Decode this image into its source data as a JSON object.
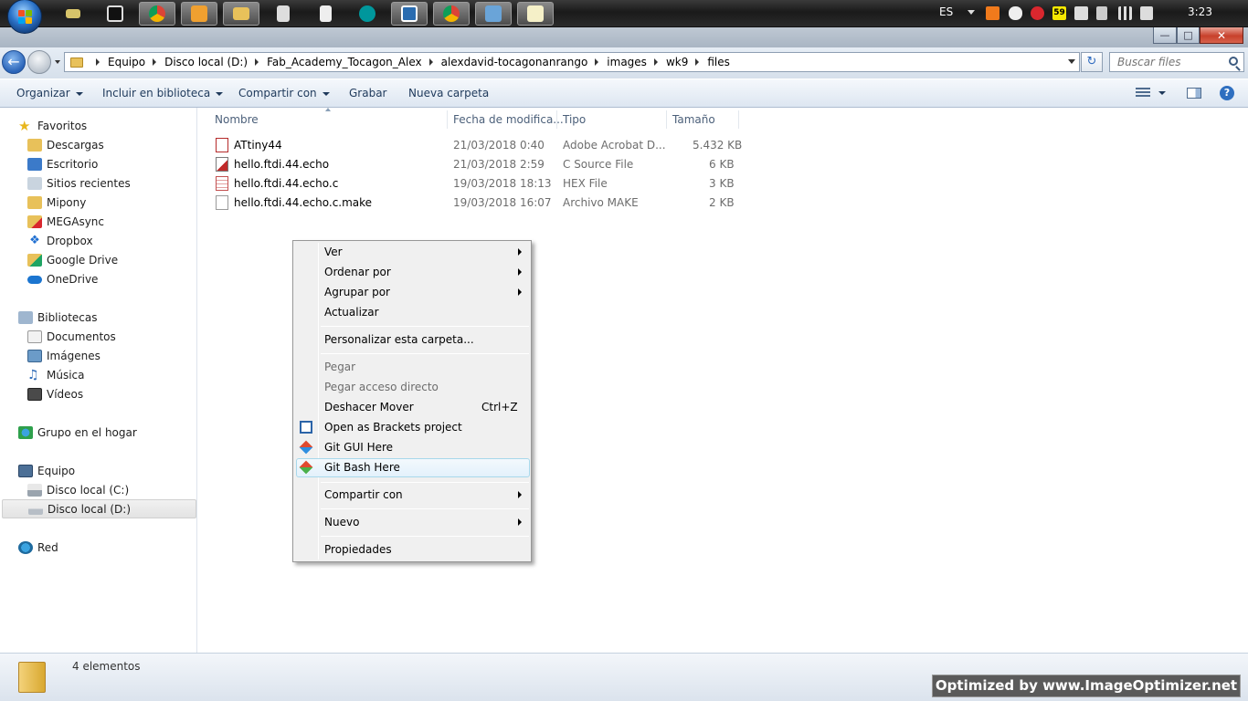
{
  "taskbar": {
    "language": "ES",
    "badge_count": "59",
    "clock": "3:23",
    "colors": {
      "bar": "#262626",
      "active_button": "#6a6a6a"
    }
  },
  "address": {
    "breadcrumbs": [
      "Equipo",
      "Disco local (D:)",
      "Fab_Academy_Tocagon_Alex",
      "alexdavid-tocagonanrango",
      "images",
      "wk9",
      "files"
    ]
  },
  "search": {
    "placeholder": "Buscar files"
  },
  "commandbar": {
    "organize": "Organizar",
    "include_library": "Incluir en biblioteca",
    "share_with": "Compartir con",
    "burn": "Grabar",
    "new_folder": "Nueva carpeta"
  },
  "nav": {
    "favorites_header": "Favoritos",
    "favorites": [
      "Descargas",
      "Escritorio",
      "Sitios recientes",
      "Mipony",
      "MEGAsync",
      "Dropbox",
      "Google Drive",
      "OneDrive"
    ],
    "libraries_header": "Bibliotecas",
    "libraries": [
      "Documentos",
      "Imágenes",
      "Música",
      "Vídeos"
    ],
    "homegroup": "Grupo en el hogar",
    "computer_header": "Equipo",
    "drives": [
      "Disco local (C:)",
      "Disco local (D:)"
    ],
    "network": "Red"
  },
  "columns": {
    "name": "Nombre",
    "date": "Fecha de modifica...",
    "type": "Tipo",
    "size": "Tamaño"
  },
  "files": [
    {
      "name": "ATtiny44",
      "date": "21/03/2018 0:40",
      "type": "Adobe Acrobat D...",
      "size": "5.432 KB",
      "icon": "pdf-icon"
    },
    {
      "name": "hello.ftdi.44.echo",
      "date": "21/03/2018 2:59",
      "type": "C Source File",
      "size": "6 KB",
      "icon": "c-source-icon"
    },
    {
      "name": "hello.ftdi.44.echo.c",
      "date": "19/03/2018 18:13",
      "type": "HEX File",
      "size": "3 KB",
      "icon": "hex-file-icon"
    },
    {
      "name": "hello.ftdi.44.echo.c.make",
      "date": "19/03/2018 16:07",
      "type": "Archivo MAKE",
      "size": "2 KB",
      "icon": "blank-file-icon"
    }
  ],
  "context_menu": {
    "view": "Ver",
    "sort_by": "Ordenar por",
    "group_by": "Agrupar por",
    "refresh": "Actualizar",
    "customize": "Personalizar esta carpeta...",
    "paste": "Pegar",
    "paste_shortcut": "Pegar acceso directo",
    "undo_move": "Deshacer Mover",
    "undo_shortcut": "Ctrl+Z",
    "brackets": "Open as Brackets project",
    "git_gui": "Git GUI Here",
    "git_bash": "Git Bash Here",
    "share_with": "Compartir con",
    "new": "Nuevo",
    "properties": "Propiedades"
  },
  "status": {
    "count": "4 elementos"
  },
  "watermark": "Optimized by www.ImageOptimizer.net"
}
